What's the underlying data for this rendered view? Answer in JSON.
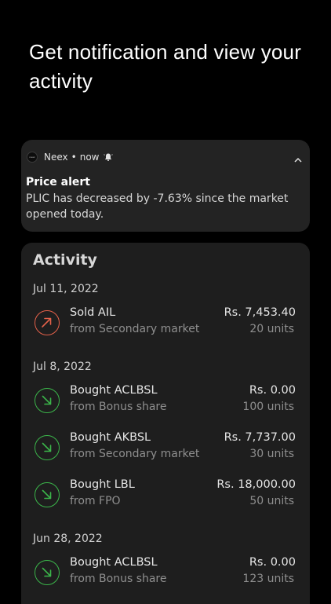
{
  "headline": "Get notification and view your activity",
  "notification": {
    "app_icon_text": "neex",
    "app_name": "Neex",
    "separator": "•",
    "time": "now",
    "title": "Price alert",
    "body": "PLIC has decreased by -7.63% since the market opened today."
  },
  "activity": {
    "title": "Activity",
    "groups": [
      {
        "date": "Jul 11, 2022",
        "items": [
          {
            "title": "Sold AIL",
            "subtitle": "from Secondary market",
            "amount": "Rs. 7,453.40",
            "units": "20 units",
            "type": "sell"
          }
        ]
      },
      {
        "date": "Jul 8, 2022",
        "items": [
          {
            "title": "Bought ACLBSL",
            "subtitle": "from Bonus share",
            "amount": "Rs. 0.00",
            "units": "100 units",
            "type": "buy"
          },
          {
            "title": "Bought AKBSL",
            "subtitle": "from Secondary market",
            "amount": "Rs. 7,737.00",
            "units": "30 units",
            "type": "buy"
          },
          {
            "title": "Bought LBL",
            "subtitle": "from FPO",
            "amount": "Rs. 18,000.00",
            "units": "50 units",
            "type": "buy"
          }
        ]
      },
      {
        "date": "Jun 28, 2022",
        "items": [
          {
            "title": "Bought ACLBSL",
            "subtitle": "from Bonus share",
            "amount": "Rs. 0.00",
            "units": "123 units",
            "type": "buy"
          }
        ]
      }
    ]
  },
  "colors": {
    "background": "#000000",
    "card": "#1e1e1e",
    "notification_card": "#232323",
    "sell": "#e4614a",
    "buy": "#3bb54a"
  },
  "icons": {
    "sell": "arrow-up-right-icon",
    "buy": "arrow-down-right-icon",
    "notification_bell": "bell-icon",
    "collapse": "chevron-up-icon"
  }
}
